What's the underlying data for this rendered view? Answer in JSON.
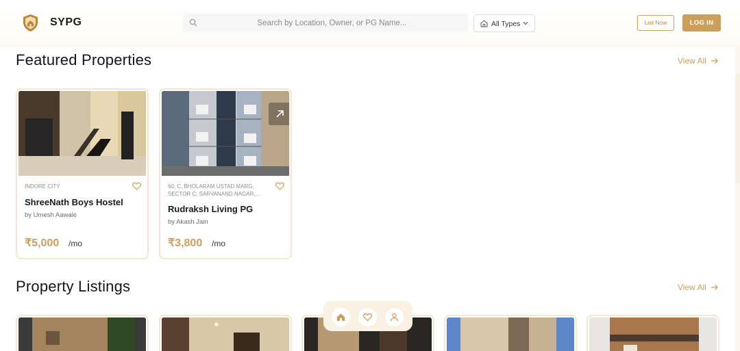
{
  "header": {
    "brand": "SYPG",
    "search_placeholder": "Search by Location, Owner, or PG Name...",
    "type_filter": "All Types",
    "list_now": "List Now",
    "login": "LOG IN"
  },
  "featured": {
    "title": "Featured Properties",
    "view_all": "View All",
    "cards": [
      {
        "location": "INDORE CITY",
        "name": "ShreeNath Boys Hostel",
        "owner": "by Umesh Aawale",
        "price": "₹5,000",
        "per": "/mo"
      },
      {
        "location": "60, C, BHOLARAM USTAD MARG, SECTOR C, SARVANAND NAGAR,...",
        "name": "Rudraksh Living PG",
        "owner": "by Akash Jain",
        "price": "₹3,800",
        "per": "/mo"
      }
    ]
  },
  "listings": {
    "title": "Property Listings",
    "view_all": "View All"
  },
  "icons": {
    "logo": "shield-logo-icon",
    "search": "search-icon",
    "type": "home-icon",
    "favorite": "heart-icon",
    "external": "arrow-up-right-icon",
    "nav": [
      "home-icon",
      "heart-icon",
      "user-icon"
    ]
  },
  "colors": {
    "accent": "#caa05c",
    "card_border": "#f5e6cf"
  }
}
